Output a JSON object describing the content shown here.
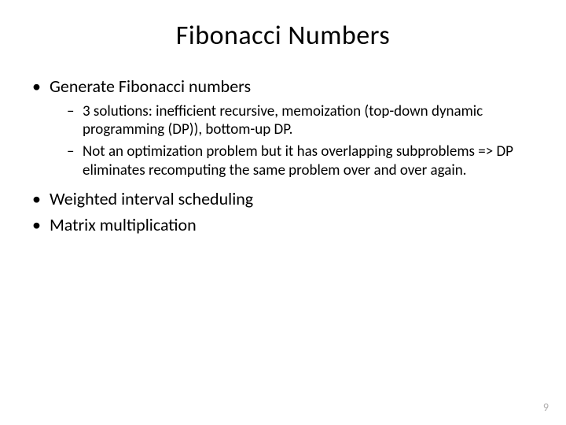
{
  "title": "Fibonacci Numbers",
  "bullets": {
    "b1": "Generate Fibonacci numbers",
    "b1_sub1": "3 solutions: inefficient recursive, memoization (top-down dynamic programming (DP)), bottom-up DP.",
    "b1_sub2": "Not an optimization problem but it has overlapping subproblems => DP eliminates recomputing the same problem over and over again.",
    "b2": "Weighted interval scheduling",
    "b3": "Matrix multiplication"
  },
  "page_number": "9"
}
